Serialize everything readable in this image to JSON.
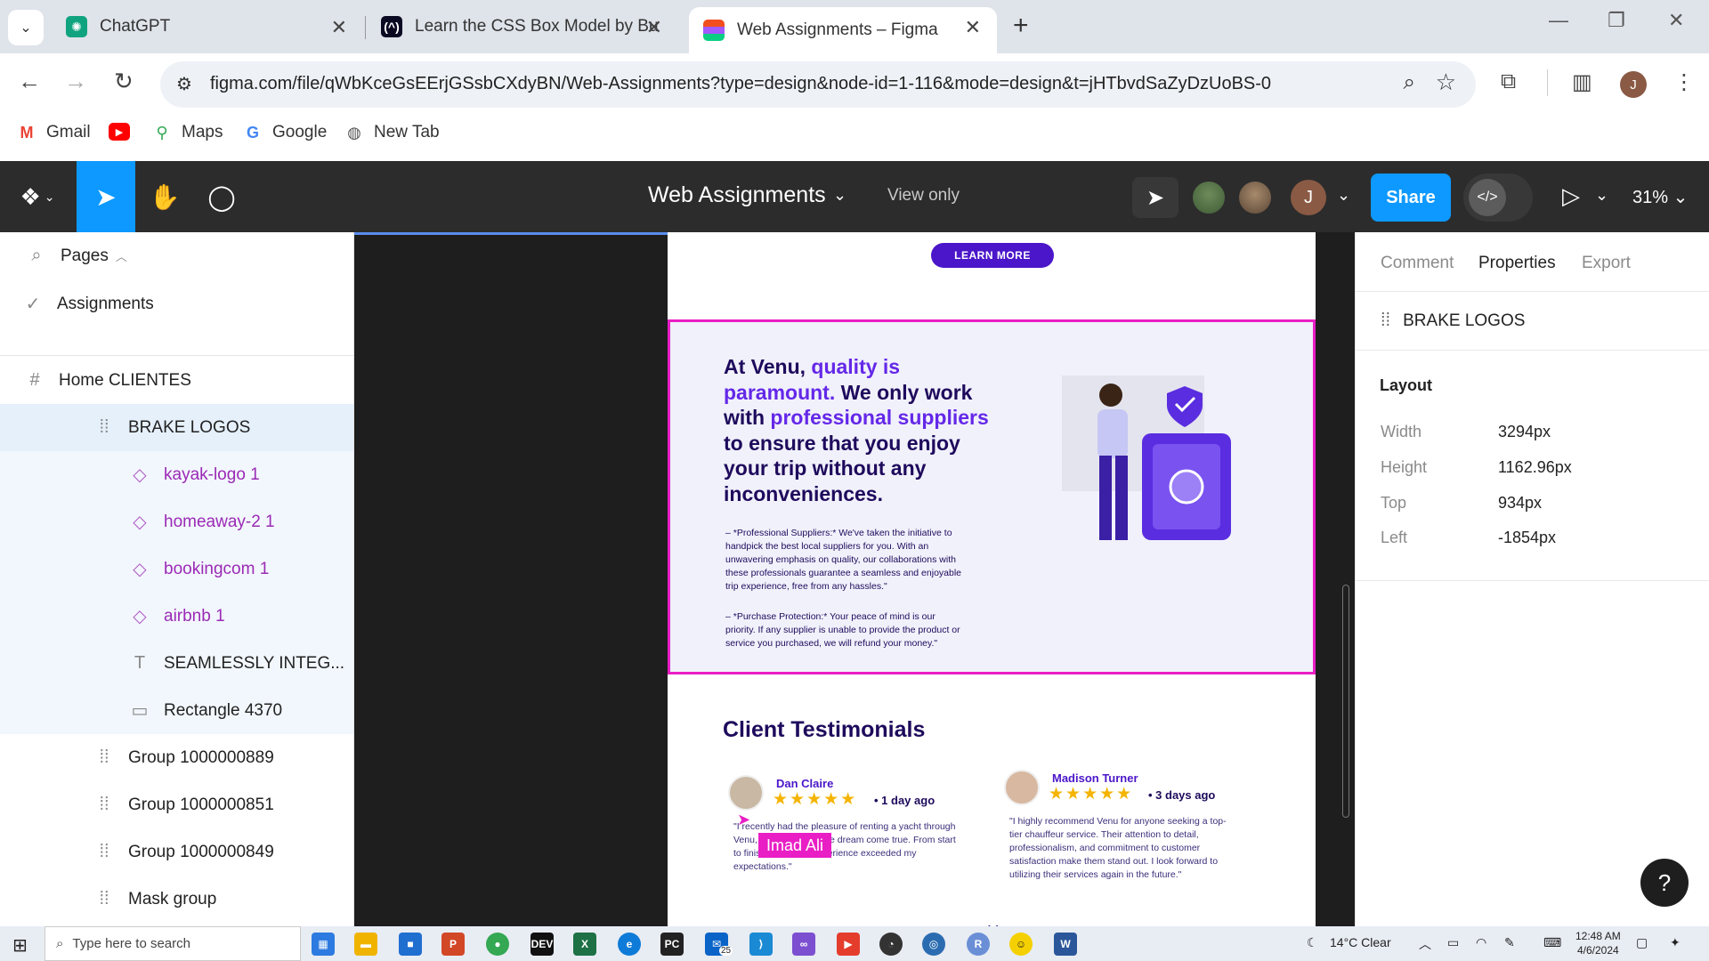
{
  "browser": {
    "tabs": [
      {
        "title": "ChatGPT",
        "icon": "chatgpt-icon"
      },
      {
        "title": "Learn the CSS Box Model by Bu",
        "icon": "freecodecamp-icon"
      },
      {
        "title": "Web Assignments – Figma",
        "icon": "figma-icon"
      }
    ],
    "url": "figma.com/file/qWbKceGsEErjGSsbCXdyBN/Web-Assignments?type=design&node-id=1-116&mode=design&t=jHTbvdSaZyDzUoBS-0",
    "profile_initial": "J",
    "bookmarks": [
      {
        "label": "Gmail",
        "icon": "gmail-icon"
      },
      {
        "label": "",
        "icon": "youtube-icon"
      },
      {
        "label": "Maps",
        "icon": "maps-icon"
      },
      {
        "label": "Google",
        "icon": "google-icon"
      },
      {
        "label": "New Tab",
        "icon": "globe-icon"
      }
    ]
  },
  "figma": {
    "file_title": "Web Assignments",
    "view_mode": "View only",
    "user_initial": "J",
    "share_label": "Share",
    "zoom": "31%"
  },
  "layers": {
    "pages_label": "Pages",
    "current_page": "Assignments",
    "frame": "Home CLIENTES",
    "items": [
      {
        "label": "BRAKE LOGOS",
        "kind": "group"
      },
      {
        "label": "kayak-logo 1",
        "kind": "component"
      },
      {
        "label": "homeaway-2 1",
        "kind": "component"
      },
      {
        "label": "bookingcom 1",
        "kind": "component"
      },
      {
        "label": "airbnb 1",
        "kind": "component"
      },
      {
        "label": "SEAMLESSLY INTEG...",
        "kind": "text"
      },
      {
        "label": "Rectangle 4370",
        "kind": "rectangle"
      },
      {
        "label": "Group 1000000889",
        "kind": "group"
      },
      {
        "label": "Group 1000000851",
        "kind": "group"
      },
      {
        "label": "Group 1000000849",
        "kind": "group"
      },
      {
        "label": "Mask group",
        "kind": "group"
      }
    ]
  },
  "canvas": {
    "learn_more": "LEARN MORE",
    "venu_head_1": "At Venu,",
    "venu_head_2": "quality is paramount.",
    "venu_head_3": "We only work with",
    "venu_head_4": "professional suppliers",
    "venu_head_5": "to ensure that you enjoy your trip without any inconveniences.",
    "para_1": "– *Professional Suppliers:* We've taken the initiative to handpick the best local suppliers for you. With an unwavering emphasis on quality, our collaborations with these professionals guarantee a seamless and enjoyable trip experience, free from any hassles.\"",
    "para_2": "– *Purchase Protection:* Your peace of mind is our priority. If any supplier is unable to provide the product or service you purchased, we will refund your money.\"",
    "testimonials_title": "Client Testimonials",
    "reviews": [
      {
        "name": "Dan Claire",
        "stars": "★★★★★",
        "when": "• 1 day ago",
        "quote": "\"I recently had the pleasure of renting a yacht through Venu, it was an absolute dream come true. From start to finish, the entire experience exceeded my expectations.\""
      },
      {
        "name": "Madison Turner",
        "stars": "★★★★★",
        "when": "• 3 days ago",
        "quote": "\"I highly recommend Venu for anyone seeking a top-tier chauffeur service. Their attention to detail, professionalism, and commitment to customer satisfaction make them stand out. I look forward to utilizing their services again in the future.\""
      }
    ],
    "cursor_label": "Imad Ali"
  },
  "properties": {
    "tabs": [
      "Comment",
      "Properties",
      "Export"
    ],
    "active_tab": "Properties",
    "selected_name": "BRAKE LOGOS",
    "layout_title": "Layout",
    "rows": [
      {
        "label": "Width",
        "value": "3294px"
      },
      {
        "label": "Height",
        "value": "1162.96px"
      },
      {
        "label": "Top",
        "value": "934px"
      },
      {
        "label": "Left",
        "value": "-1854px"
      }
    ]
  },
  "taskbar": {
    "search_placeholder": "Type here to search",
    "weather": "14°C  Clear",
    "time": "12:48 AM",
    "date": "4/6/2024",
    "mail_badge": "25"
  },
  "colors": {
    "figma_blue": "#0d99ff",
    "figma_dark": "#2c2c2c",
    "selection_pink": "#e91ec5",
    "brand_purple": "#4b16c9"
  }
}
